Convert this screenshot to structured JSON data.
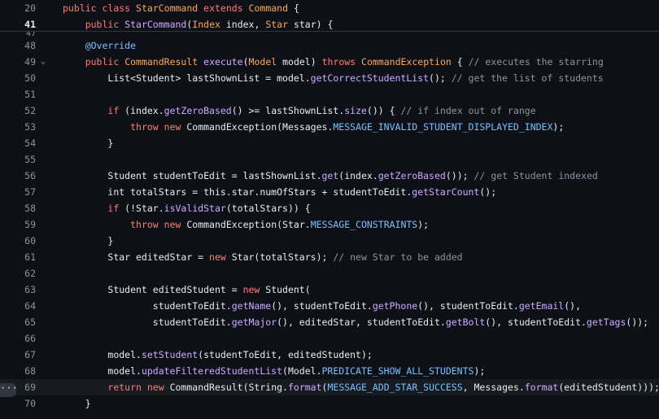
{
  "sticky": [
    {
      "n": "20",
      "indent": 0,
      "tokens": [
        [
          "k",
          "public"
        ],
        [
          "v",
          " "
        ],
        [
          "k",
          "class"
        ],
        [
          "v",
          " "
        ],
        [
          "t",
          "StarCommand"
        ],
        [
          "v",
          " "
        ],
        [
          "k",
          "extends"
        ],
        [
          "v",
          " "
        ],
        [
          "t",
          "Command"
        ],
        [
          "v",
          " {"
        ]
      ]
    },
    {
      "n": "41",
      "indent": 4,
      "tokens": [
        [
          "k",
          "public"
        ],
        [
          "v",
          " "
        ],
        [
          "f",
          "StarCommand"
        ],
        [
          "v",
          "("
        ],
        [
          "t",
          "Index"
        ],
        [
          "v",
          " index, "
        ],
        [
          "t",
          "Star"
        ],
        [
          "v",
          " star) {"
        ]
      ]
    }
  ],
  "partial_line": "47",
  "lines": [
    {
      "n": "48",
      "indent": 4,
      "tokens": [
        [
          "cst",
          "@Override"
        ]
      ]
    },
    {
      "n": "49",
      "indent": 4,
      "fold": "⌄",
      "tokens": [
        [
          "k",
          "public"
        ],
        [
          "v",
          " "
        ],
        [
          "t",
          "CommandResult"
        ],
        [
          "v",
          " "
        ],
        [
          "f",
          "execute"
        ],
        [
          "v",
          "("
        ],
        [
          "t",
          "Model"
        ],
        [
          "v",
          " model) "
        ],
        [
          "k",
          "throws"
        ],
        [
          "v",
          " "
        ],
        [
          "t",
          "CommandException"
        ],
        [
          "v",
          " { "
        ],
        [
          "c",
          "// executes the starring"
        ]
      ]
    },
    {
      "n": "50",
      "indent": 8,
      "tokens": [
        [
          "v",
          "List<Student> lastShownList = model."
        ],
        [
          "f",
          "getCorrectStudentList"
        ],
        [
          "v",
          "(); "
        ],
        [
          "c",
          "// get the list of students"
        ]
      ]
    },
    {
      "n": "51",
      "indent": 0,
      "tokens": []
    },
    {
      "n": "52",
      "indent": 8,
      "tokens": [
        [
          "k",
          "if"
        ],
        [
          "v",
          " (index."
        ],
        [
          "f",
          "getZeroBased"
        ],
        [
          "v",
          "() >= lastShownList."
        ],
        [
          "f",
          "size"
        ],
        [
          "v",
          "()) { "
        ],
        [
          "c",
          "// if index out of range"
        ]
      ]
    },
    {
      "n": "53",
      "indent": 12,
      "tokens": [
        [
          "k",
          "throw"
        ],
        [
          "v",
          " "
        ],
        [
          "k",
          "new"
        ],
        [
          "v",
          " CommandException(Messages."
        ],
        [
          "cst",
          "MESSAGE_INVALID_STUDENT_DISPLAYED_INDEX"
        ],
        [
          "v",
          ");"
        ]
      ]
    },
    {
      "n": "54",
      "indent": 8,
      "tokens": [
        [
          "v",
          "}"
        ]
      ]
    },
    {
      "n": "55",
      "indent": 0,
      "tokens": []
    },
    {
      "n": "56",
      "indent": 8,
      "tokens": [
        [
          "v",
          "Student studentToEdit = lastShownList."
        ],
        [
          "f",
          "get"
        ],
        [
          "v",
          "(index."
        ],
        [
          "f",
          "getZeroBased"
        ],
        [
          "v",
          "()); "
        ],
        [
          "c",
          "// get Student indexed"
        ]
      ]
    },
    {
      "n": "57",
      "indent": 8,
      "tokens": [
        [
          "v",
          "int totalStars = this.star.numOfStars + studentToEdit."
        ],
        [
          "f",
          "getStarCount"
        ],
        [
          "v",
          "();"
        ]
      ]
    },
    {
      "n": "58",
      "indent": 8,
      "tokens": [
        [
          "k",
          "if"
        ],
        [
          "v",
          " (!Star."
        ],
        [
          "f",
          "isValidStar"
        ],
        [
          "v",
          "(totalStars)) {"
        ]
      ]
    },
    {
      "n": "59",
      "indent": 12,
      "tokens": [
        [
          "k",
          "throw"
        ],
        [
          "v",
          " "
        ],
        [
          "k",
          "new"
        ],
        [
          "v",
          " CommandException(Star."
        ],
        [
          "cst",
          "MESSAGE_CONSTRAINTS"
        ],
        [
          "v",
          ");"
        ]
      ]
    },
    {
      "n": "60",
      "indent": 8,
      "tokens": [
        [
          "v",
          "}"
        ]
      ]
    },
    {
      "n": "61",
      "indent": 8,
      "tokens": [
        [
          "v",
          "Star editedStar = "
        ],
        [
          "k",
          "new"
        ],
        [
          "v",
          " Star(totalStars); "
        ],
        [
          "c",
          "// new Star to be added"
        ]
      ]
    },
    {
      "n": "62",
      "indent": 0,
      "tokens": []
    },
    {
      "n": "63",
      "indent": 8,
      "tokens": [
        [
          "v",
          "Student editedStudent = "
        ],
        [
          "k",
          "new"
        ],
        [
          "v",
          " Student("
        ]
      ]
    },
    {
      "n": "64",
      "indent": 16,
      "tokens": [
        [
          "v",
          "studentToEdit."
        ],
        [
          "f",
          "getName"
        ],
        [
          "v",
          "(), studentToEdit."
        ],
        [
          "f",
          "getPhone"
        ],
        [
          "v",
          "(), studentToEdit."
        ],
        [
          "f",
          "getEmail"
        ],
        [
          "v",
          "(),"
        ]
      ]
    },
    {
      "n": "65",
      "indent": 16,
      "tokens": [
        [
          "v",
          "studentToEdit."
        ],
        [
          "f",
          "getMajor"
        ],
        [
          "v",
          "(), editedStar, studentToEdit."
        ],
        [
          "f",
          "getBolt"
        ],
        [
          "v",
          "(), studentToEdit."
        ],
        [
          "f",
          "getTags"
        ],
        [
          "v",
          "());"
        ]
      ]
    },
    {
      "n": "66",
      "indent": 0,
      "tokens": []
    },
    {
      "n": "67",
      "indent": 8,
      "tokens": [
        [
          "v",
          "model."
        ],
        [
          "f",
          "setStudent"
        ],
        [
          "v",
          "(studentToEdit, editedStudent);"
        ]
      ]
    },
    {
      "n": "68",
      "indent": 8,
      "tokens": [
        [
          "v",
          "model."
        ],
        [
          "f",
          "updateFilteredStudentList"
        ],
        [
          "v",
          "(Model."
        ],
        [
          "cst",
          "PREDICATE_SHOW_ALL_STUDENTS"
        ],
        [
          "v",
          ");"
        ]
      ]
    },
    {
      "n": "69",
      "indent": 8,
      "highlight": true,
      "tokens": [
        [
          "k",
          "return"
        ],
        [
          "v",
          " "
        ],
        [
          "k",
          "new"
        ],
        [
          "v",
          " CommandResult(String."
        ],
        [
          "f",
          "format"
        ],
        [
          "v",
          "("
        ],
        [
          "cst",
          "MESSAGE_ADD_STAR_SUCCESS"
        ],
        [
          "v",
          ", Messages."
        ],
        [
          "f",
          "format"
        ],
        [
          "v",
          "(editedStudent)));"
        ]
      ]
    },
    {
      "n": "70",
      "indent": 4,
      "tokens": [
        [
          "v",
          "}"
        ]
      ]
    }
  ],
  "line_menu_icon": "kebab-dots-icon",
  "line_menu_label": "···"
}
